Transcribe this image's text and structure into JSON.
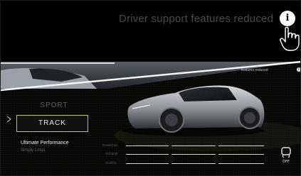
{
  "banner": {
    "title": "Driver support features reduced",
    "info_glyph": "i"
  },
  "overlay_note": {
    "text": "features reduced",
    "info_glyph": "i"
  },
  "drive_modes": {
    "items": [
      "SPORT",
      "TRACK"
    ],
    "selected": "TRACK",
    "accent_color": "#b8c64a"
  },
  "performance": {
    "title": "Ultimate Performance",
    "subtitle": "Simply Lotus"
  },
  "stats": [
    {
      "label": "Powertrain"
    },
    {
      "label": "Exhaust"
    },
    {
      "label": "Stability"
    }
  ],
  "icons": {
    "info": "info-icon",
    "pointer": "hand-pointer-icon",
    "chevron": "chevron-right-icon",
    "traction": "traction-control-off-icon"
  },
  "traction_badge": "OFF"
}
